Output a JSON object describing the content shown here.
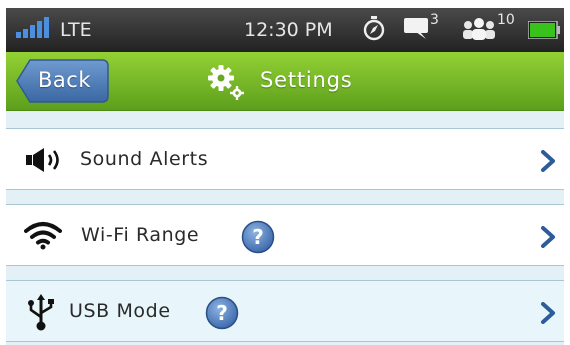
{
  "status_bar": {
    "network": "LTE",
    "time": "12:30 PM",
    "messages_count": "3",
    "people_count": "10",
    "icons": [
      "signal-icon",
      "compass-icon",
      "chat-icon",
      "people-icon",
      "battery-icon"
    ]
  },
  "header": {
    "back_label": "Back",
    "title": "Settings",
    "icon": "gear-icon"
  },
  "settings_items": [
    {
      "label": "Sound Alerts",
      "icon": "speaker-icon",
      "help": false
    },
    {
      "label": "Wi-Fi Range",
      "icon": "wifi-icon",
      "help": true
    },
    {
      "label": "USB Mode",
      "icon": "usb-icon",
      "help": true
    }
  ],
  "colors": {
    "header_green": "#7dbf2a",
    "back_button_blue": "#4f7fb8",
    "chevron_blue": "#2d5c9a",
    "row_highlight": "#e8f6fb",
    "battery_green": "#39c21b"
  }
}
